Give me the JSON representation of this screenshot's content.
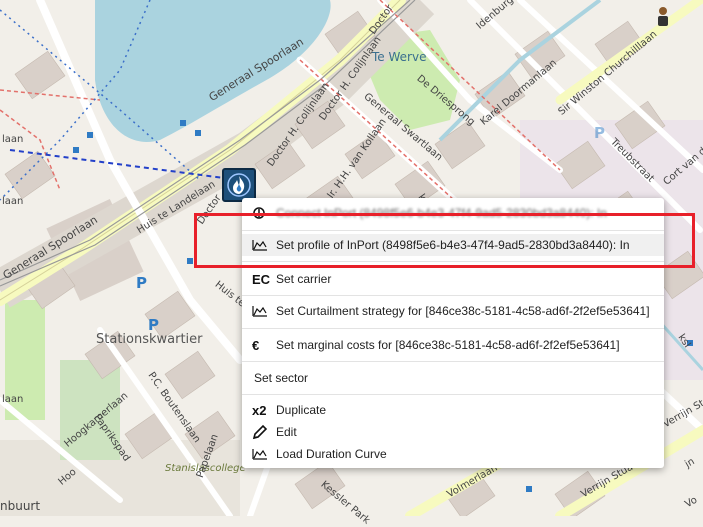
{
  "map": {
    "streets": [
      "Generaal Spoorlaan",
      "Generaal Spoorlaan",
      "Doctor H. Colijnlaan",
      "Doctor H. Colijnlaan",
      "Ir. H.H. van Kollaan",
      "Generaal Swartlaan",
      "De Driesprong",
      "Karel Doormanlaan",
      "Idenburglaan",
      "Sir Winston Churchilllaan",
      "Treubstraat",
      "Cort van der",
      "Huis te Landelaan",
      "Huis te",
      "P.C. Boutenslaan",
      "Papelaan",
      "Paprikspad",
      "Hoogkamerlaan",
      "Kessler Park",
      "Volmerlaan",
      "Verrijn Stuartlaan",
      "Verrijn St",
      "Doctor",
      "Doctor",
      "Hoo",
      "Vo",
      "jn"
    ],
    "places": [
      "Te Werve",
      "Stationskwartier",
      "Stanislascollege",
      "nbuurt",
      "laan",
      "laan",
      "laan",
      "ksl"
    ],
    "parking_symbol": "P"
  },
  "asset_marker": {
    "icon": "flame-icon"
  },
  "context_menu": {
    "items": [
      {
        "icon": "connect-icon",
        "label": "Connect InPort (8498f5e6-b4e3-47f4-9ad5-2830bd3a8440): In"
      },
      {
        "icon": "profile-chart-icon",
        "label": "Set profile of InPort (8498f5e6-b4e3-47f4-9ad5-2830bd3a8440): In"
      },
      {
        "icon": "ec-icon",
        "icon_text": "EC",
        "label": "Set carrier"
      },
      {
        "icon": "curtailment-chart-icon",
        "label": "Set Curtailment strategy for [846ce38c-5181-4c58-ad6f-2f2ef5e53641]"
      },
      {
        "icon": "euro-icon",
        "icon_text": "€",
        "label": "Set marginal costs for [846ce38c-5181-4c58-ad6f-2f2ef5e53641]"
      },
      {
        "icon": "",
        "label": "Set sector"
      },
      {
        "icon": "duplicate-icon",
        "icon_text": "x2",
        "label": "Duplicate"
      },
      {
        "icon": "pencil-icon",
        "label": "Edit"
      },
      {
        "icon": "load-duration-chart-icon",
        "label": "Load Duration Curve"
      }
    ]
  },
  "highlight": {
    "color": "#e8202a"
  }
}
